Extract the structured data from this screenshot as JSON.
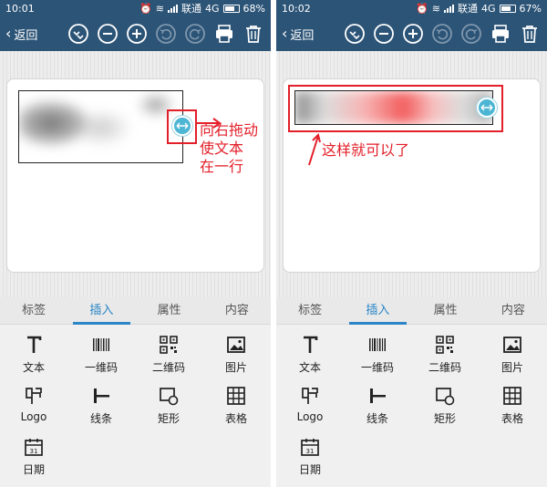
{
  "screens": [
    {
      "status": {
        "time": "10:01",
        "carrier": "联通",
        "network": "4G",
        "battery": "68%"
      },
      "toolbar": {
        "back_label": "返回"
      },
      "annotation": {
        "text_lines": [
          "向右拖动",
          "使文本",
          "在一行"
        ]
      }
    },
    {
      "status": {
        "time": "10:02",
        "carrier": "联通",
        "network": "4G",
        "battery": "67%"
      },
      "toolbar": {
        "back_label": "返回"
      },
      "annotation": {
        "text_lines": [
          "这样就可以了"
        ]
      }
    }
  ],
  "tabs": [
    "标签",
    "插入",
    "属性",
    "内容"
  ],
  "active_tab": 1,
  "insert_items": [
    {
      "label": "文本",
      "icon": "text-icon"
    },
    {
      "label": "一维码",
      "icon": "barcode-icon"
    },
    {
      "label": "二维码",
      "icon": "qrcode-icon"
    },
    {
      "label": "图片",
      "icon": "image-icon"
    },
    {
      "label": "Logo",
      "icon": "logo-icon"
    },
    {
      "label": "线条",
      "icon": "line-icon"
    },
    {
      "label": "矩形",
      "icon": "rectangle-icon"
    },
    {
      "label": "表格",
      "icon": "table-icon"
    },
    {
      "label": "日期",
      "icon": "calendar-icon"
    }
  ],
  "colors": {
    "toolbar": "#2c5477",
    "accent": "#2a86c7",
    "annotation": "#e3202a",
    "handle": "#4db6d4"
  }
}
